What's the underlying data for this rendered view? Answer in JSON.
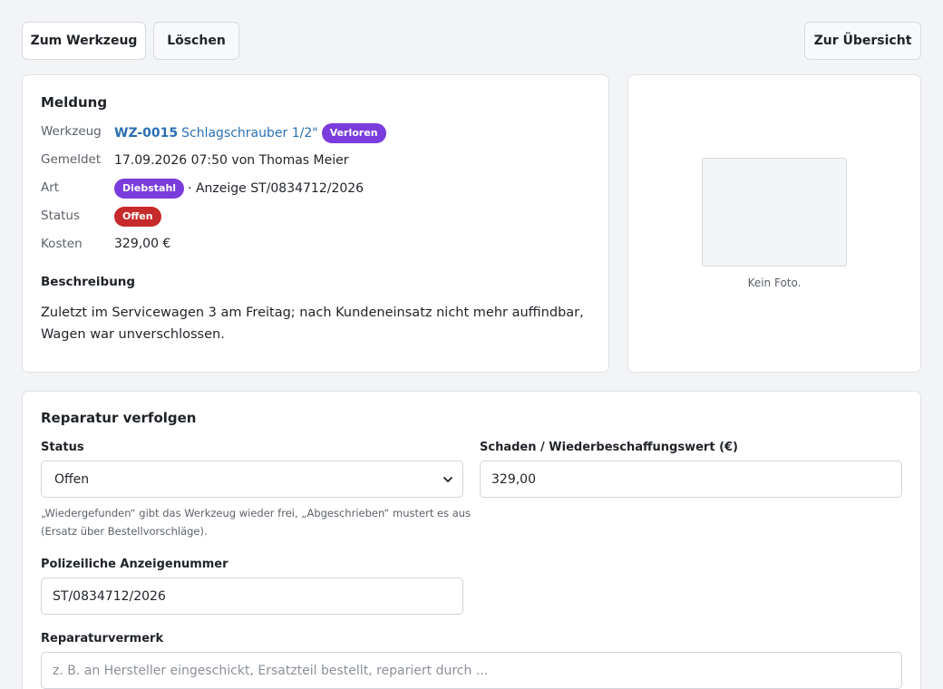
{
  "toolbar": {
    "to_tool_label": "Zum Werkzeug",
    "delete_label": "Löschen",
    "overview_label": "Zur Übersicht"
  },
  "report": {
    "title": "Meldung",
    "rows": {
      "tool": {
        "label": "Werkzeug",
        "code": "WZ-0015",
        "name": "Schlagschrauber 1/2\"",
        "badge": "Verloren"
      },
      "reported": {
        "label": "Gemeldet",
        "value": "17.09.2026 07:50 von Thomas Meier"
      },
      "type": {
        "label": "Art",
        "badge": "Diebstahl",
        "extra": "· Anzeige ST/0834712/2026"
      },
      "status": {
        "label": "Status",
        "badge": "Offen"
      },
      "cost": {
        "label": "Kosten",
        "value": "329,00 €"
      }
    },
    "description_title": "Beschreibung",
    "description": "Zuletzt im Servicewagen 3 am Freitag; nach Kundeneinsatz nicht mehr auffindbar, Wagen war unverschlossen."
  },
  "photo": {
    "caption": "Kein Foto."
  },
  "repair": {
    "title": "Reparatur verfolgen",
    "status_label": "Status",
    "status_value": "Offen",
    "status_hint": "„Wiedergefunden“ gibt das Werkzeug wieder frei, „Abgeschrieben“ mustert es aus (Ersatz über Bestellvorschläge).",
    "damage_label": "Schaden / Wiederbeschaffungswert (€)",
    "damage_value": "329,00",
    "police_label": "Polizeiliche Anzeigenummer",
    "police_value": "ST/0834712/2026",
    "note_label": "Reparaturvermerk",
    "note_placeholder": "z. B. an Hersteller eingeschickt, Ersatzteil bestellt, repariert durch ..."
  },
  "colors": {
    "link": "#2a6fb5",
    "badge_purple": "#7a3cdc",
    "badge_red": "#c62a2a"
  },
  "icons": {
    "select_arrow": "chevron-down-icon"
  }
}
